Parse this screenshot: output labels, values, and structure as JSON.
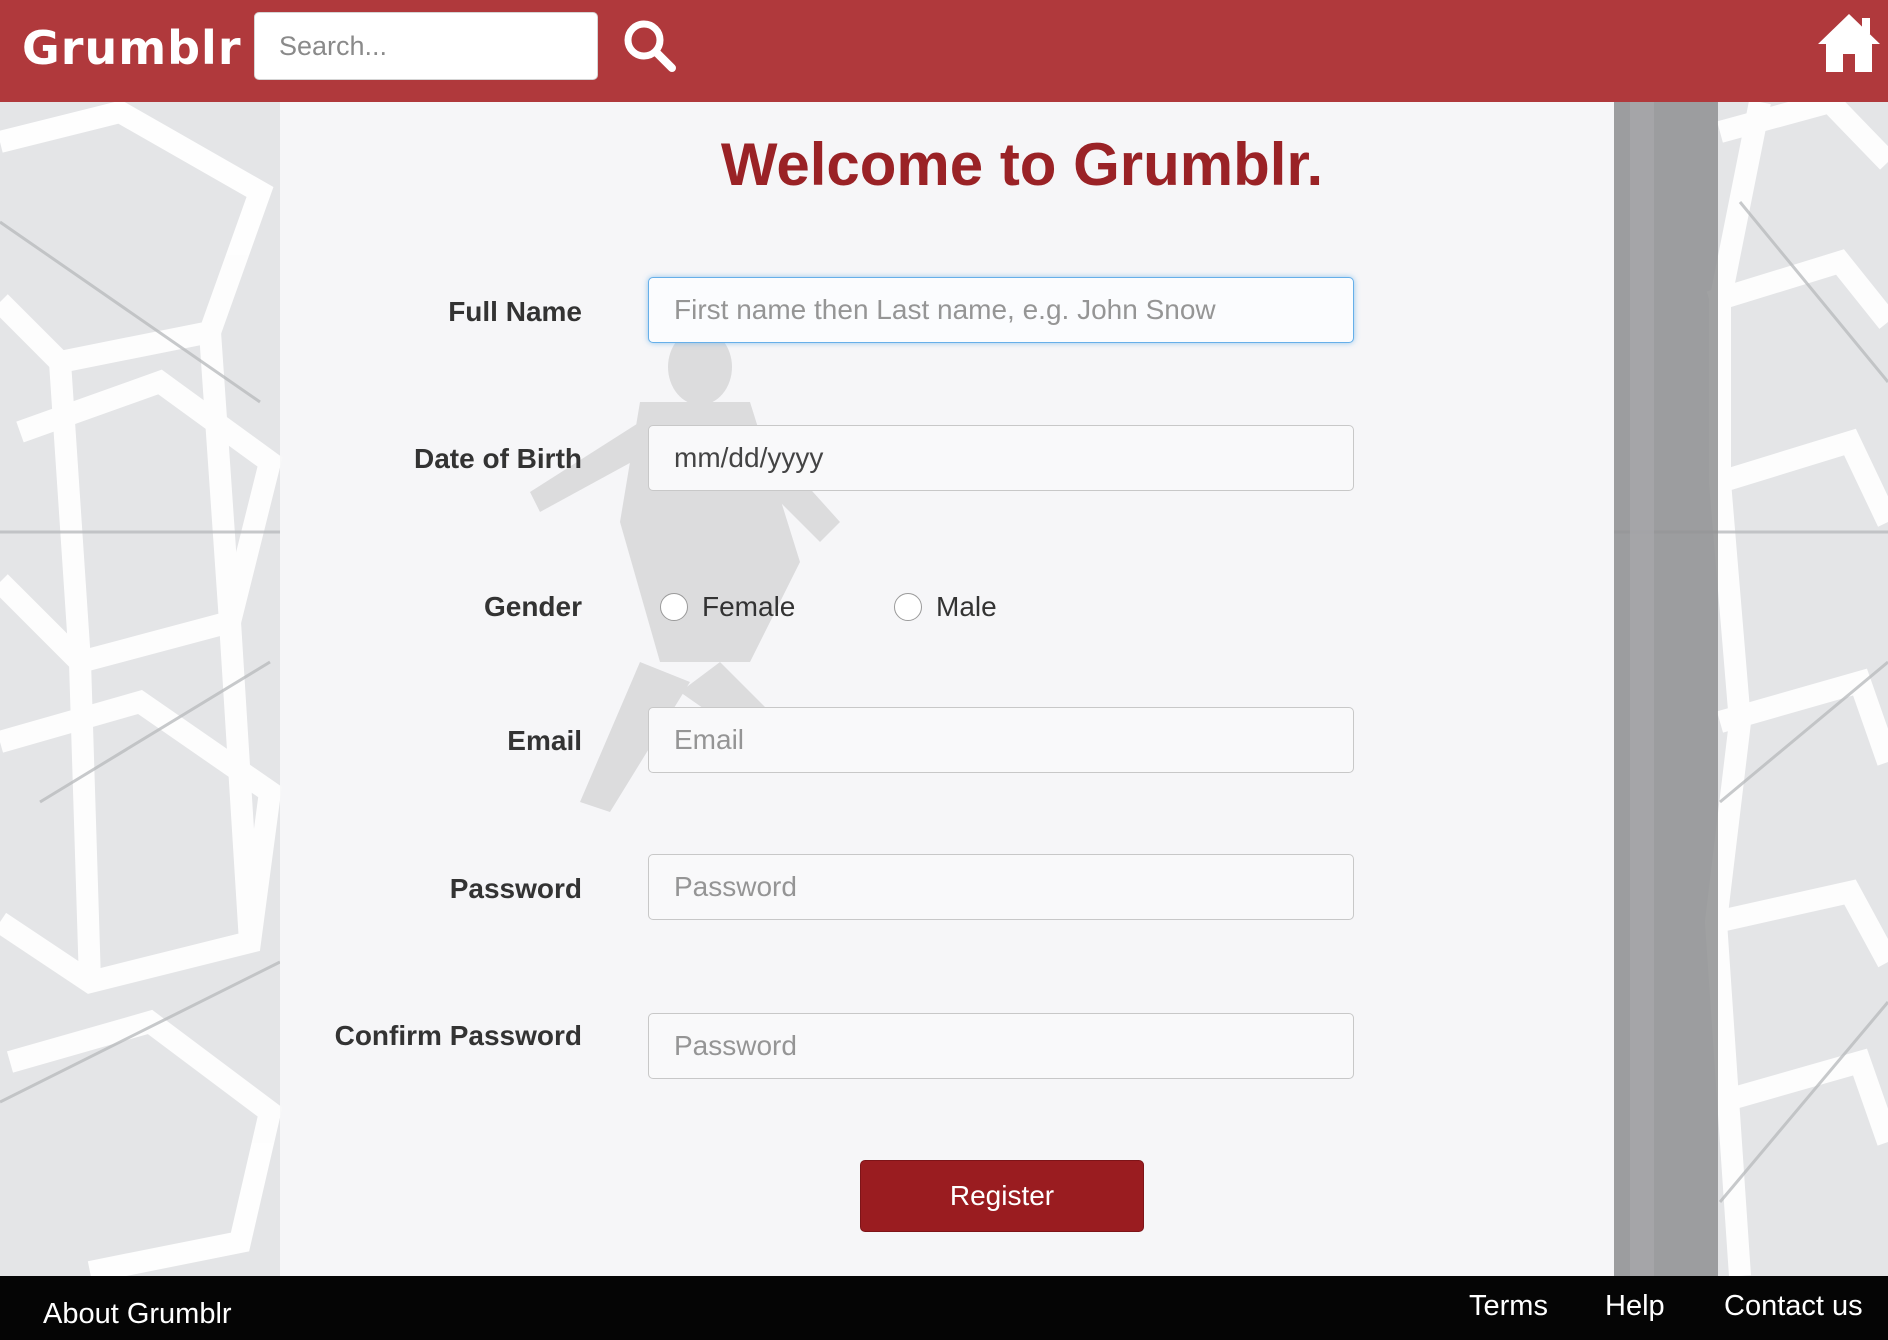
{
  "header": {
    "brand": "Grumblr",
    "search_placeholder": "Search...",
    "search_icon": "search-icon",
    "home_icon": "home-icon",
    "color": "#b0393c"
  },
  "form": {
    "title": "Welcome to Grumblr.",
    "full_name": {
      "label": "Full Name",
      "placeholder": "First name then Last name, e.g. John Snow"
    },
    "dob": {
      "label": "Date of Birth",
      "placeholder": "mm/dd/yyyy"
    },
    "gender": {
      "label": "Gender",
      "options": [
        "Female",
        "Male"
      ]
    },
    "email": {
      "label": "Email",
      "placeholder": "Email"
    },
    "password": {
      "label": "Password",
      "placeholder": "Password"
    },
    "confirm_password": {
      "label": "Confirm Password",
      "placeholder": "Password"
    },
    "submit_label": "Register",
    "accent_color": "#9a2226"
  },
  "footer": {
    "about": "About Grumblr",
    "links": [
      "Terms",
      "Help",
      "Contact us"
    ]
  }
}
